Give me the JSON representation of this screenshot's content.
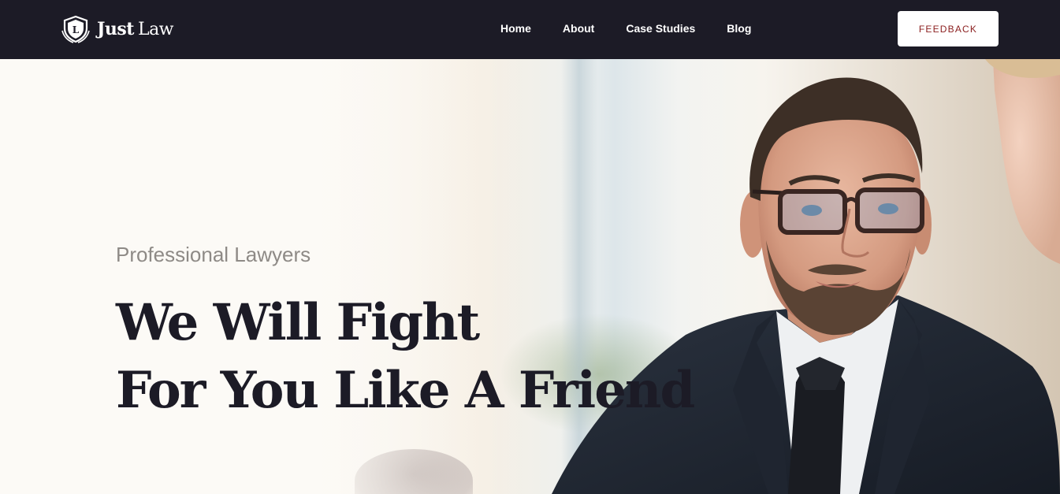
{
  "brand": {
    "logo_icon": "shield-icon",
    "logo_letter": "L",
    "name_bold": "Just",
    "name_light": "Law"
  },
  "nav": {
    "items": [
      {
        "label": "Home"
      },
      {
        "label": "About"
      },
      {
        "label": "Case Studies"
      },
      {
        "label": "Blog"
      }
    ],
    "cta_label": "FEEDBACK"
  },
  "hero": {
    "subtitle": "Professional Lawyers",
    "headline_line1": "We Will Fight",
    "headline_line2": "For You Like A Friend"
  },
  "colors": {
    "navbar_bg": "#1c1b26",
    "cta_text": "#8b1e1e",
    "headline": "#1c1b26",
    "subtitle": "#8e8a86"
  }
}
